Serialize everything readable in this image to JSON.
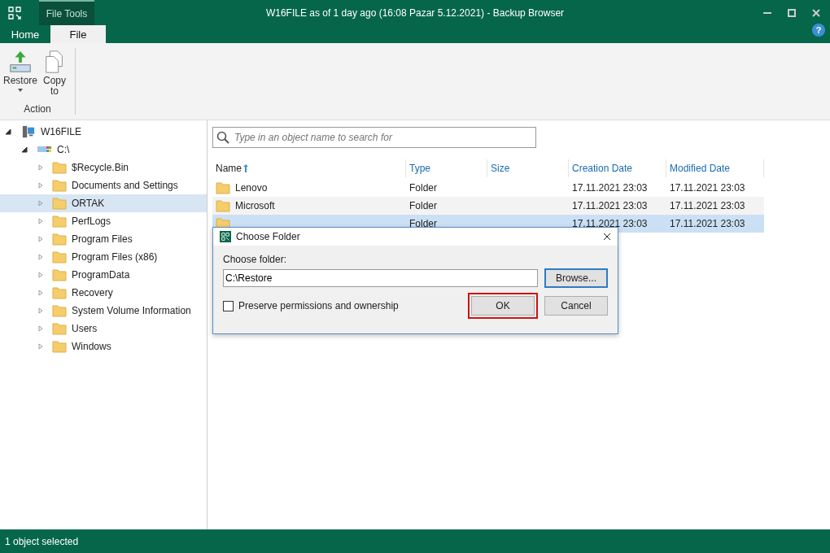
{
  "window": {
    "title": "W16FILE as of 1 day ago (16:08 Pazar 5.12.2021) - Backup Browser"
  },
  "context_tab": {
    "label": "File Tools"
  },
  "help": {
    "label": "?"
  },
  "tabs": [
    {
      "label": "Home",
      "selected": false
    },
    {
      "label": "File",
      "selected": true
    }
  ],
  "ribbon": {
    "buttons": [
      {
        "label": "Restore",
        "kind": "restore",
        "dropdown": true
      },
      {
        "label": "Copy to",
        "kind": "copy",
        "dropdown": false
      }
    ],
    "group": "Action"
  },
  "tree": {
    "label": "W16FILE",
    "expanded": true,
    "children": [
      {
        "label": "C:\\",
        "expanded": true,
        "children": [
          {
            "label": "$Recycle.Bin",
            "selected": false
          },
          {
            "label": "Documents and Settings",
            "selected": false
          },
          {
            "label": "ORTAK",
            "selected": true
          },
          {
            "label": "PerfLogs",
            "selected": false
          },
          {
            "label": "Program Files",
            "selected": false
          },
          {
            "label": "Program Files (x86)",
            "selected": false
          },
          {
            "label": "ProgramData",
            "selected": false
          },
          {
            "label": "Recovery",
            "selected": false
          },
          {
            "label": "System Volume Information",
            "selected": false
          },
          {
            "label": "Users",
            "selected": false
          },
          {
            "label": "Windows",
            "selected": false
          }
        ]
      }
    ]
  },
  "search": {
    "placeholder": "Type in an object name to search for"
  },
  "table": {
    "columns": [
      {
        "label": "Name",
        "sorted": true
      },
      {
        "label": "Type",
        "sorted": false
      },
      {
        "label": "Size",
        "sorted": false
      },
      {
        "label": "Creation Date",
        "sorted": false
      },
      {
        "label": "Modified Date",
        "sorted": false
      }
    ],
    "rows": [
      {
        "name": "Lenovo",
        "type": "Folder",
        "creation_date": "17.11.2021 23:03",
        "modified_date": "17.11.2021 23:03",
        "selected": false
      },
      {
        "name": "Microsoft",
        "type": "Folder",
        "creation_date": "17.11.2021 23:03",
        "modified_date": "17.11.2021 23:03",
        "selected": false
      },
      {
        "type": "Folder",
        "creation_date": "17.11.2021 23:03",
        "modified_date": "17.11.2021 23:03",
        "selected": true
      }
    ]
  },
  "dialog": {
    "title": "Choose Folder",
    "field_label": "Choose folder:",
    "value": "C:\\Restore",
    "browse": "Browse...",
    "checkbox": {
      "label": "Preserve permissions and ownership",
      "checked": false
    },
    "ok": "OK",
    "cancel": "Cancel",
    "ok_highlighted": true
  },
  "status_bar": "1 object selected"
}
